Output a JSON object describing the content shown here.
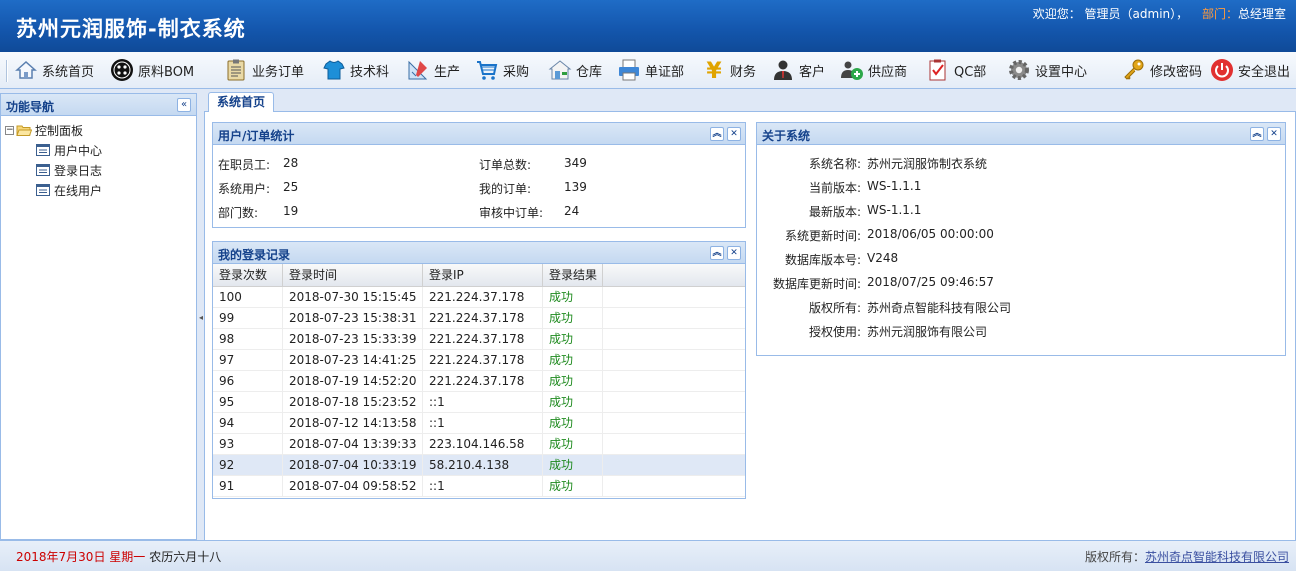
{
  "header": {
    "title": "苏州元润服饰-制衣系统",
    "welcome_prefix": "欢迎您：",
    "user": "管理员（admin），",
    "dept_label": "部门：",
    "dept": "总经理室"
  },
  "toolbar": {
    "items": [
      {
        "label": "系统首页",
        "icon": "home-icon"
      },
      {
        "label": "原料BOM",
        "icon": "bom-icon"
      },
      {
        "label": "业务订单",
        "icon": "clipboard-icon"
      },
      {
        "label": "技术科",
        "icon": "shirt-icon"
      },
      {
        "label": "生产",
        "icon": "drafting-icon"
      },
      {
        "label": "采购",
        "icon": "cart-icon"
      },
      {
        "label": "仓库",
        "icon": "warehouse-icon"
      },
      {
        "label": "单证部",
        "icon": "printer-icon"
      },
      {
        "label": "财务",
        "icon": "yen-icon"
      },
      {
        "label": "客户",
        "icon": "customer-icon"
      },
      {
        "label": "供应商",
        "icon": "supplier-icon"
      },
      {
        "label": "QC部",
        "icon": "checklist-icon"
      },
      {
        "label": "设置中心",
        "icon": "gear-icon"
      },
      {
        "label": "修改密码",
        "icon": "key-icon"
      },
      {
        "label": "安全退出",
        "icon": "power-icon"
      }
    ]
  },
  "sidebar": {
    "title": "功能导航",
    "collapse": "«",
    "root": "控制面板",
    "items": [
      "用户中心",
      "登录日志",
      "在线用户"
    ]
  },
  "tab": {
    "label": "系统首页"
  },
  "stats_panel": {
    "title": "用户/订单统计",
    "left": [
      {
        "label": "在职员工:",
        "value": "28"
      },
      {
        "label": "系统用户:",
        "value": "25"
      },
      {
        "label": "部门数:",
        "value": "19"
      }
    ],
    "right": [
      {
        "label": "订单总数:",
        "value": "349"
      },
      {
        "label": "我的订单:",
        "value": "139"
      },
      {
        "label": "审核中订单:",
        "value": "24"
      }
    ]
  },
  "login_panel": {
    "title": "我的登录记录",
    "columns": [
      "登录次数",
      "登录时间",
      "登录IP",
      "登录结果"
    ],
    "rows": [
      [
        "100",
        "2018-07-30 15:15:45",
        "221.224.37.178",
        "成功"
      ],
      [
        "99",
        "2018-07-23 15:38:31",
        "221.224.37.178",
        "成功"
      ],
      [
        "98",
        "2018-07-23 15:33:39",
        "221.224.37.178",
        "成功"
      ],
      [
        "97",
        "2018-07-23 14:41:25",
        "221.224.37.178",
        "成功"
      ],
      [
        "96",
        "2018-07-19 14:52:20",
        "221.224.37.178",
        "成功"
      ],
      [
        "95",
        "2018-07-18 15:23:52",
        "::1",
        "成功"
      ],
      [
        "94",
        "2018-07-12 14:13:58",
        "::1",
        "成功"
      ],
      [
        "93",
        "2018-07-04 13:39:33",
        "223.104.146.58",
        "成功"
      ],
      [
        "92",
        "2018-07-04 10:33:19",
        "58.210.4.138",
        "成功"
      ],
      [
        "91",
        "2018-07-04 09:58:52",
        "::1",
        "成功"
      ]
    ],
    "selected_row": 8
  },
  "about_panel": {
    "title": "关于系统",
    "rows": [
      {
        "label": "系统名称:",
        "value": "苏州元润服饰制衣系统"
      },
      {
        "label": "当前版本:",
        "value": "WS-1.1.1"
      },
      {
        "label": "最新版本:",
        "value": "WS-1.1.1"
      },
      {
        "label": "系统更新时间:",
        "value": "2018/06/05 00:00:00"
      },
      {
        "label": "数据库版本号:",
        "value": "V248"
      },
      {
        "label": "数据库更新时间:",
        "value": "2018/07/25 09:46:57"
      },
      {
        "label": "版权所有:",
        "value": "苏州奇点智能科技有限公司"
      },
      {
        "label": "授权使用:",
        "value": "苏州元润服饰有限公司"
      }
    ]
  },
  "footer": {
    "date": "2018年7月30日 星期一",
    "lunar": "农历六月十八",
    "copyright_label": "版权所有：",
    "copyright_link": "苏州奇点智能科技有限公司"
  },
  "colors": {
    "header": "#1457ae",
    "accent": "#15428b",
    "success": "#1e8a1e",
    "date": "#cc0000"
  }
}
